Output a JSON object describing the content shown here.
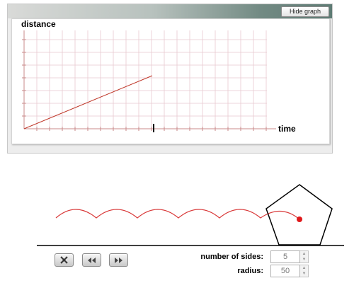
{
  "graph": {
    "hide_button_label": "Hide graph",
    "y_axis_label": "distance",
    "x_axis_label": "time",
    "line_color": "#c0392b",
    "grid_color": "#e8c8cf",
    "axis_color": "#c98a8a"
  },
  "simulation": {
    "pentagon_stroke": "#000000",
    "trace_color": "#d93a3a",
    "marker_color": "#e0181a"
  },
  "controls": {
    "buttons": [
      {
        "name": "reset-button",
        "icon": "close-x-icon"
      },
      {
        "name": "rewind-button",
        "icon": "rewind-icon"
      },
      {
        "name": "fast-forward-button",
        "icon": "fast-forward-icon"
      }
    ],
    "sides_label": "number of sides:",
    "sides_value": "5",
    "radius_label": "radius:",
    "radius_value": "50"
  }
}
